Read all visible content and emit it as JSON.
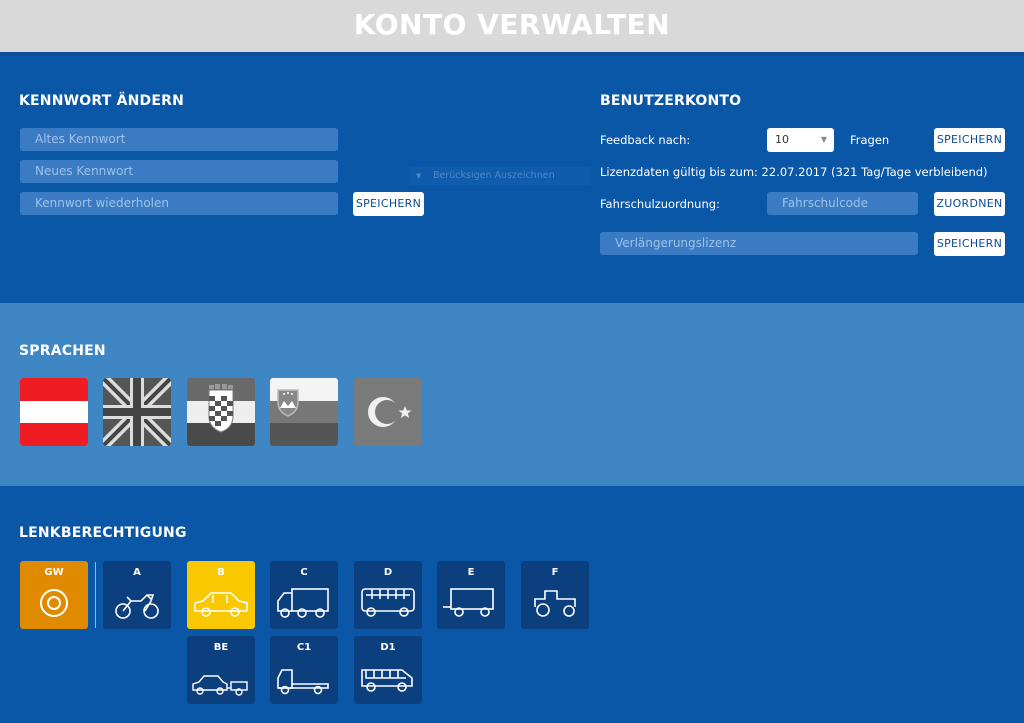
{
  "header": {
    "title": "KONTO VERWALTEN"
  },
  "password": {
    "title": "KENNWORT ÄNDERN",
    "old_placeholder": "Altes Kennwort",
    "new_placeholder": "Neues Kennwort",
    "repeat_placeholder": "Kennwort wiederholen",
    "save_label": "SPEICHERN",
    "ghost_select_text": "Berücksigen Auszeichnen"
  },
  "account": {
    "title": "BENUTZERKONTO",
    "feedback_label": "Feedback nach:",
    "feedback_value": "10",
    "feedback_suffix": "Fragen",
    "save_label": "SPEICHERN",
    "license_text": "Lizenzdaten gültig bis zum: 22.07.2017 (321 Tag/Tage verbleibend)",
    "school_label": "Fahrschulzuordnung:",
    "school_placeholder": "Fahrschulcode",
    "assign_label": "ZUORDNEN",
    "extension_placeholder": "Verlängerungslizenz",
    "extension_save_label": "SPEICHERN"
  },
  "languages": {
    "title": "SPRACHEN",
    "flags": [
      {
        "icon": "austria-flag-icon",
        "active": true
      },
      {
        "icon": "uk-flag-icon",
        "active": false
      },
      {
        "icon": "croatia-flag-icon",
        "active": false
      },
      {
        "icon": "slovenia-flag-icon",
        "active": false
      },
      {
        "icon": "turkey-flag-icon",
        "active": false
      }
    ]
  },
  "licenses": {
    "title": "LENKBERECHTIGUNG",
    "items": [
      {
        "code": "GW",
        "icon": "circle-target-icon",
        "state": "orange"
      },
      {
        "code": "A",
        "icon": "motorcycle-icon",
        "state": "off"
      },
      {
        "code": "B",
        "icon": "car-icon",
        "state": "selected"
      },
      {
        "code": "C",
        "icon": "truck-icon",
        "state": "off"
      },
      {
        "code": "D",
        "icon": "bus-icon",
        "state": "off"
      },
      {
        "code": "E",
        "icon": "trailer-icon",
        "state": "off"
      },
      {
        "code": "F",
        "icon": "tractor-icon",
        "state": "off"
      },
      {
        "code": "BE",
        "icon": "car-trailer-icon",
        "state": "off"
      },
      {
        "code": "C1",
        "icon": "small-truck-icon",
        "state": "off"
      },
      {
        "code": "D1",
        "icon": "minibus-icon",
        "state": "off"
      }
    ]
  },
  "colors": {
    "primary": "#0a57a8",
    "light_band": "#3f86c4",
    "tile": "#0b3f7e",
    "selected": "#f9c800",
    "orange": "#e08a00"
  }
}
